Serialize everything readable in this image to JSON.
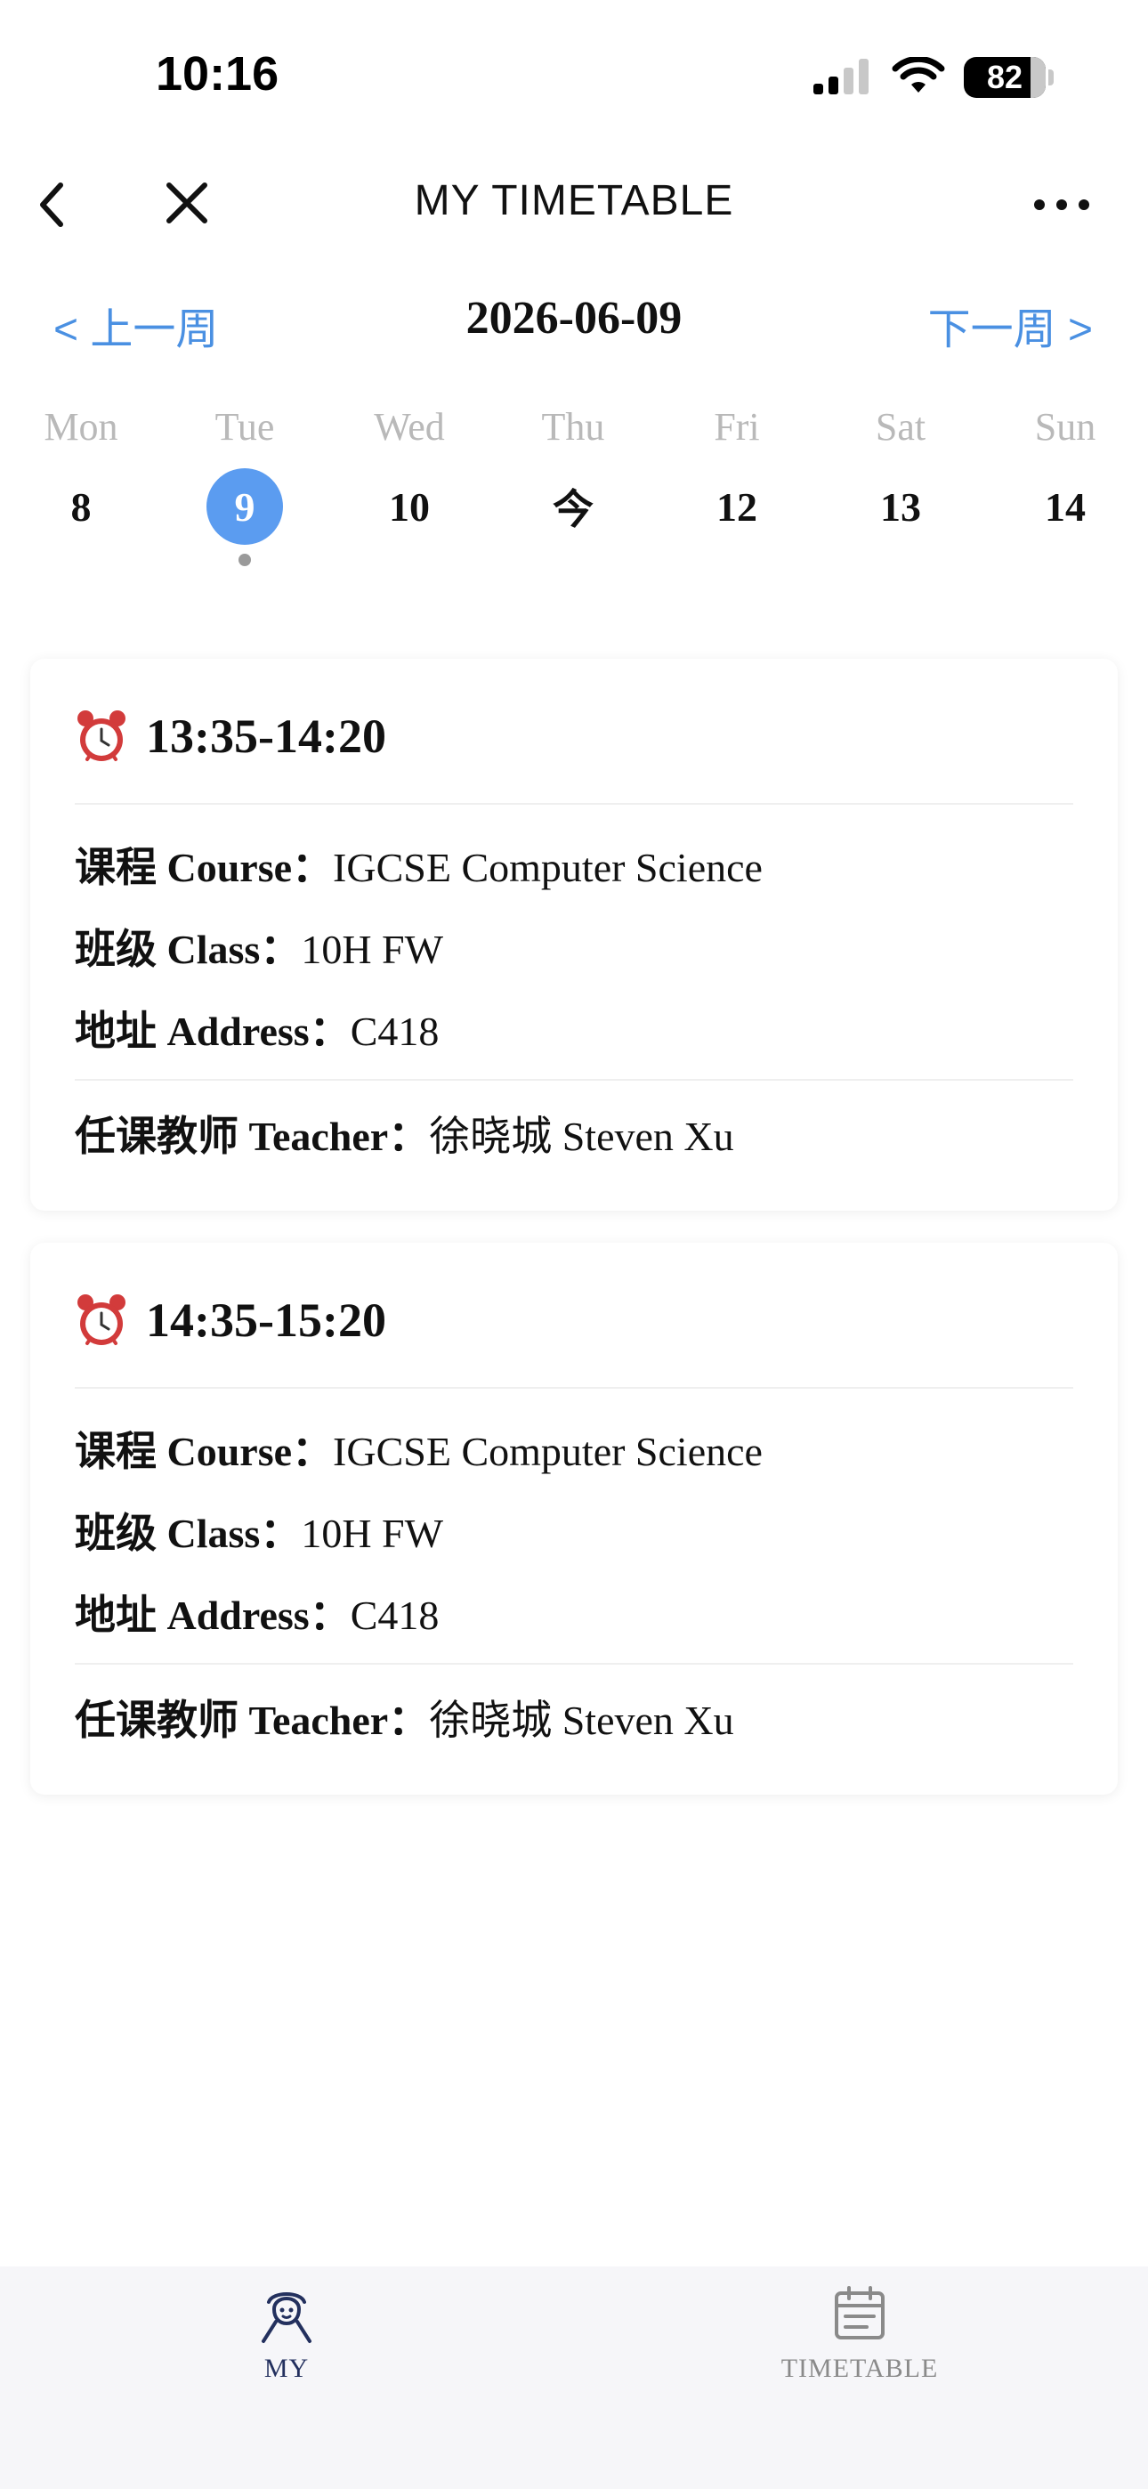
{
  "status_bar": {
    "time": "10:16",
    "battery": "82",
    "battery_level": 0.82
  },
  "nav": {
    "title": "MY TIMETABLE"
  },
  "week_nav": {
    "prev_label": "< 上一周",
    "next_label": "下一周 >",
    "current_date": "2026-06-09"
  },
  "days": [
    {
      "name": "Mon",
      "num": "8",
      "selected": false
    },
    {
      "name": "Tue",
      "num": "9",
      "selected": true
    },
    {
      "name": "Wed",
      "num": "10",
      "selected": false
    },
    {
      "name": "Thu",
      "num": "今",
      "selected": false
    },
    {
      "name": "Fri",
      "num": "12",
      "selected": false
    },
    {
      "name": "Sat",
      "num": "13",
      "selected": false
    },
    {
      "name": "Sun",
      "num": "14",
      "selected": false
    }
  ],
  "lessons": [
    {
      "time": "13:35-14:20",
      "course_label": "课程 Course：",
      "course": "IGCSE Computer Science",
      "class_label": "班级 Class：",
      "class": "10H FW",
      "address_label": "地址 Address：",
      "address": "C418",
      "teacher_label": "任课教师 Teacher：",
      "teacher": "徐晓城 Steven Xu"
    },
    {
      "time": "14:35-15:20",
      "course_label": "课程 Course：",
      "course": "IGCSE Computer Science",
      "class_label": "班级 Class：",
      "class": "10H FW",
      "address_label": "地址 Address：",
      "address": "C418",
      "teacher_label": "任课教师 Teacher：",
      "teacher": "徐晓城 Steven Xu"
    }
  ],
  "tab_bar": {
    "tabs": [
      {
        "label": "MY",
        "icon": "person-icon",
        "active": true
      },
      {
        "label": "TIMETABLE",
        "icon": "calendar-icon",
        "active": false
      }
    ]
  },
  "colors": {
    "accent": "#4a90e2",
    "selected_day": "#5b9cf0",
    "tab_active": "#23305e",
    "tab_inactive": "#8a8a8a"
  }
}
